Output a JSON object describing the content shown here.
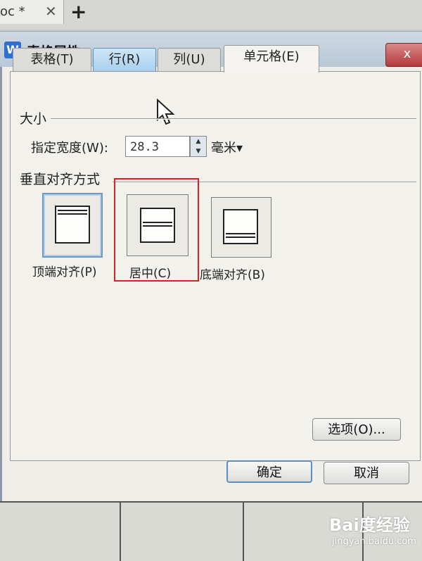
{
  "app_tabs": {
    "doc_tab": "oc *",
    "close": "✕",
    "new_tab": "+"
  },
  "dialog": {
    "title": "表格属性",
    "close": "x",
    "tabs": [
      "表格(T)",
      "行(R)",
      "列(U)",
      "单元格(E)"
    ],
    "size_section": "大小",
    "width_label": "指定宽度(W):",
    "width_value": "28.3",
    "unit": "毫米▾",
    "valign_section": "垂直对齐方式",
    "valign_options": [
      "顶端对齐(P)",
      "居中(C)",
      "底端对齐(B)"
    ],
    "options_button": "选项(O)...",
    "ok_button": "确定",
    "cancel_button": "取消"
  },
  "watermark": {
    "line1": "Bai度经验",
    "line2": "jingyan.baidu.com"
  },
  "colors": {
    "highlight": "#e02020",
    "selected_option": "#6f9ac0",
    "hover_tab": "#a8d0ee"
  }
}
